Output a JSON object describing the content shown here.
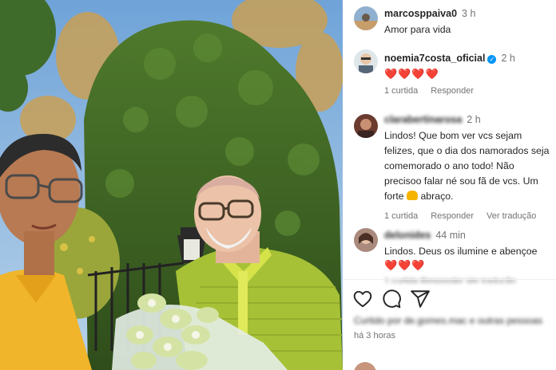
{
  "comments": [
    {
      "username": "marcosppaiva0",
      "time": "3 h",
      "text": "Amor para vida"
    },
    {
      "username": "noemia7costa_oficial",
      "verified_icon": "verified-badge-icon",
      "time": "2 h",
      "hearts": "❤️❤️❤️❤️",
      "likes": "1 curtida",
      "reply": "Responder"
    },
    {
      "username": "clarabertinarosa",
      "time": "2 h",
      "text_before_emoji": "Lindos! Que bom ver vcs sejam felizes, que o dia dos namorados seja comemorado o ano todo! Não precisoo falar né sou fã de vcs. Um forte",
      "emoji_icon": "flexed-biceps-icon",
      "text_after_emoji": "abraço.",
      "likes": "1 curtida",
      "reply": "Responder",
      "translate": "Ver tradução"
    },
    {
      "username": "delonides",
      "time": "44 min",
      "text": "Lindos. Deus os ilumine e abençoe",
      "hearts": "❤️❤️❤️"
    }
  ],
  "cut_off_actions": "1 curtida   Responder   Ver tradução",
  "action_icons": [
    "heart-icon",
    "comment-icon",
    "share-icon"
  ],
  "liked_by": "Curtido por de.gomes.mac e outras pessoas",
  "posted_ago": "há 3 horas"
}
